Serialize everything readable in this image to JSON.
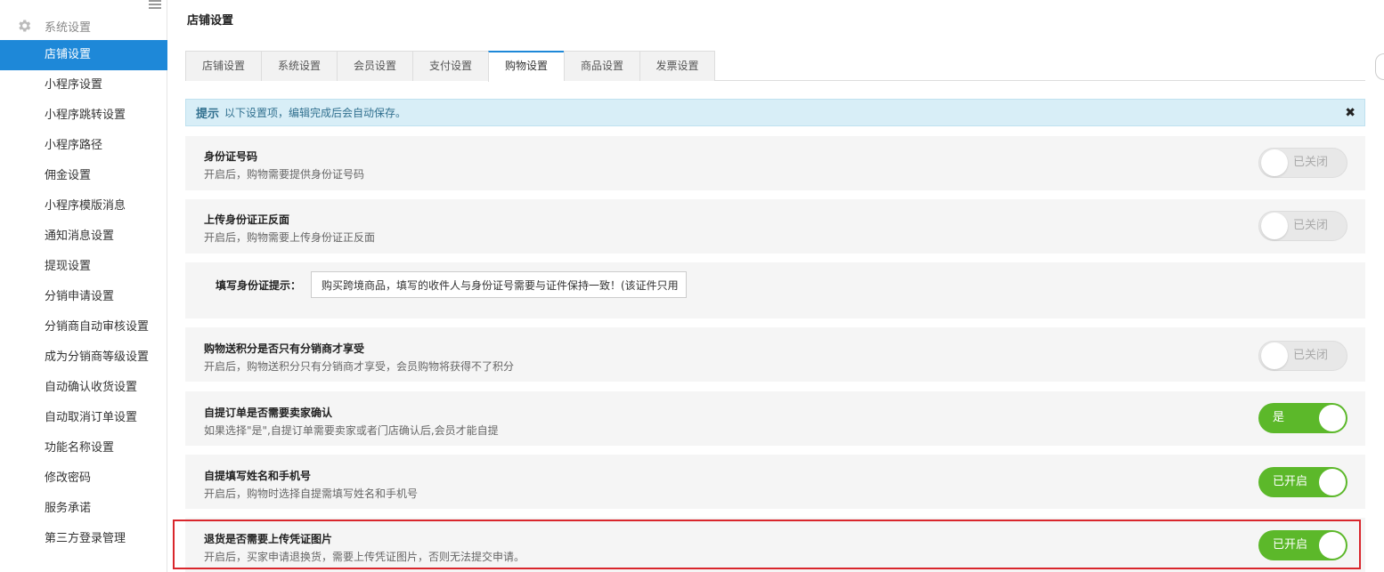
{
  "sidebar": {
    "header": "系统设置",
    "items": [
      {
        "label": "店铺设置",
        "active": true
      },
      {
        "label": "小程序设置"
      },
      {
        "label": "小程序跳转设置"
      },
      {
        "label": "小程序路径"
      },
      {
        "label": "佣金设置"
      },
      {
        "label": "小程序模版消息"
      },
      {
        "label": "通知消息设置"
      },
      {
        "label": "提现设置"
      },
      {
        "label": "分销申请设置"
      },
      {
        "label": "分销商自动审核设置"
      },
      {
        "label": "成为分销商等级设置"
      },
      {
        "label": "自动确认收货设置"
      },
      {
        "label": "自动取消订单设置"
      },
      {
        "label": "功能名称设置"
      },
      {
        "label": "修改密码"
      },
      {
        "label": "服务承诺"
      },
      {
        "label": "第三方登录管理"
      }
    ]
  },
  "main": {
    "title": "店铺设置",
    "tabs": [
      {
        "label": "店铺设置"
      },
      {
        "label": "系统设置"
      },
      {
        "label": "会员设置"
      },
      {
        "label": "支付设置"
      },
      {
        "label": "购物设置",
        "active": true
      },
      {
        "label": "商品设置"
      },
      {
        "label": "发票设置"
      }
    ],
    "tip": {
      "strong": "提示",
      "text": "以下设置项，编辑完成后会自动保存。",
      "close": "✖"
    },
    "settings": {
      "id_number": {
        "title": "身份证号码",
        "desc": "开启后，购物需要提供身份证号码",
        "switch": "已关闭"
      },
      "id_upload": {
        "title": "上传身份证正反面",
        "desc": "开启后，购物需要上传身份证正反面",
        "switch": "已关闭"
      },
      "id_hint": {
        "label": "填写身份证提示：",
        "value": "购买跨境商品，填写的收件人与身份证号需要与证件保持一致！(该证件只用"
      },
      "points": {
        "title": "购物送积分是否只有分销商才享受",
        "desc": "开启后，购物送积分只有分销商才享受，会员购物将获得不了积分",
        "switch": "已关闭"
      },
      "pickup_confirm": {
        "title": "自提订单是否需要卖家确认",
        "desc": "如果选择\"是\",自提订单需要卖家或者门店确认后,会员才能自提",
        "switch": "是"
      },
      "pickup_info": {
        "title": "自提填写姓名和手机号",
        "desc": "开启后，购物时选择自提需填写姓名和手机号",
        "switch": "已开启"
      },
      "return_photo": {
        "title": "退货是否需要上传凭证图片",
        "desc": "开启后，买家申请退换货，需要上传凭证图片，否则无法提交申请。",
        "switch": "已开启"
      }
    }
  },
  "colors": {
    "accent": "#1e88d8",
    "switch_on": "#5cb82a",
    "highlight": "#d9262c"
  }
}
